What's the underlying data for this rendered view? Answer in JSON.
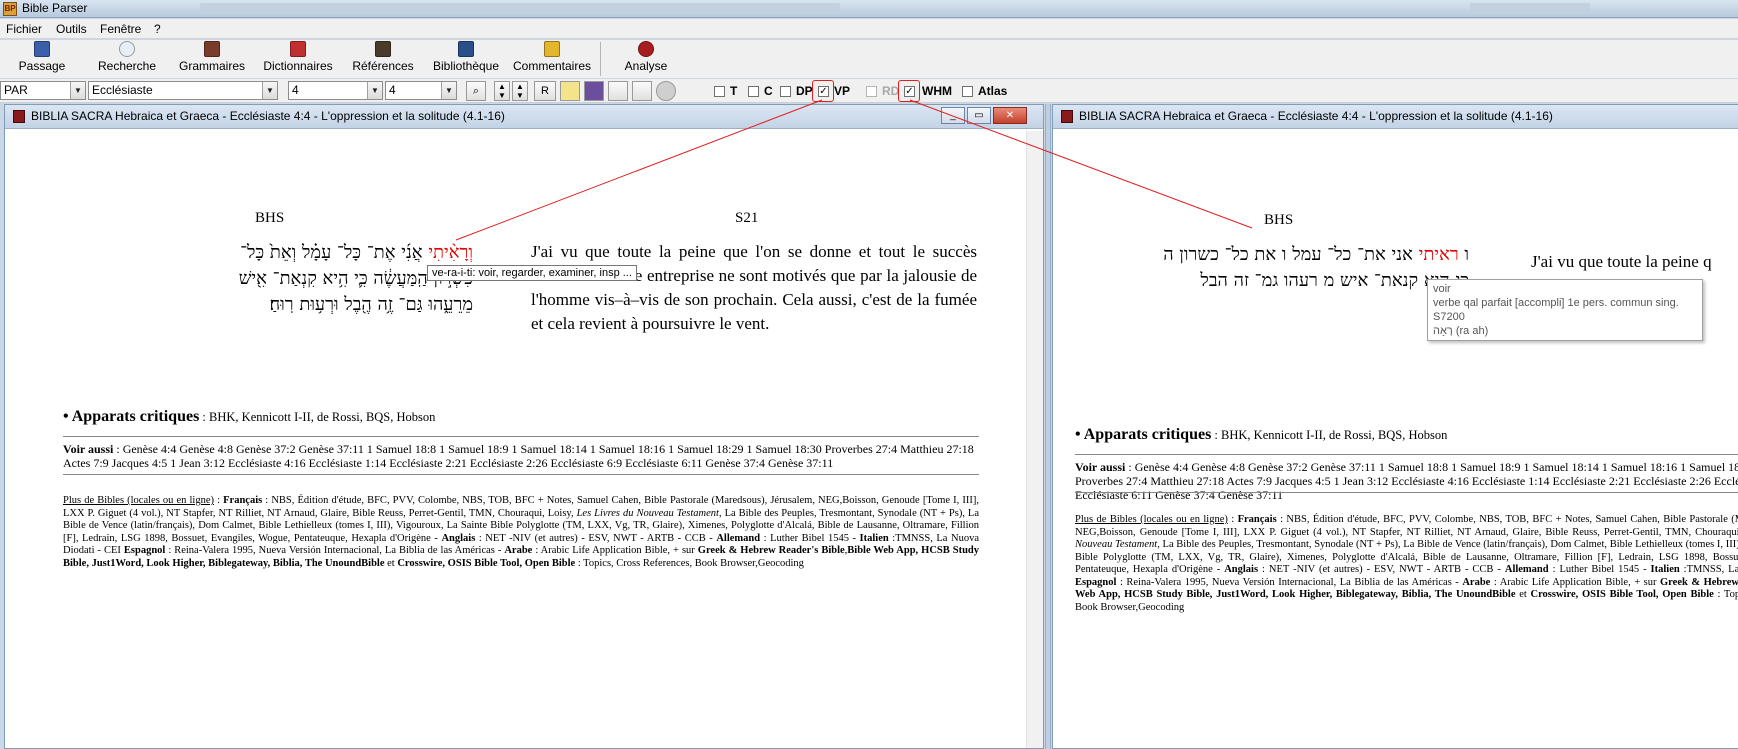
{
  "app": {
    "title": "Bible Parser"
  },
  "menu": {
    "items": [
      "Fichier",
      "Outils",
      "Fenêtre",
      "?"
    ]
  },
  "toolbar": {
    "buttons": [
      {
        "label": "Passage",
        "icon": "book-icon"
      },
      {
        "label": "Recherche",
        "icon": "magnifier-icon"
      },
      {
        "label": "Grammaires",
        "icon": "books-icon"
      },
      {
        "label": "Dictionnaires",
        "icon": "dictionary-icon"
      },
      {
        "label": "Références",
        "icon": "references-icon"
      },
      {
        "label": "Bibliothèque",
        "icon": "library-icon"
      },
      {
        "label": "Commentaires",
        "icon": "commentary-icon"
      },
      {
        "label": "Analyse",
        "icon": "analysis-icon"
      }
    ]
  },
  "selectors": {
    "version": "PAR",
    "book": "Ecclésiaste",
    "chapter": "4",
    "verse": "4",
    "r_label": "R"
  },
  "checkboxes": [
    {
      "label": "T",
      "checked": false,
      "enabled": true
    },
    {
      "label": "C",
      "checked": false,
      "enabled": true
    },
    {
      "label": "DP",
      "checked": false,
      "enabled": true
    },
    {
      "label": "VP",
      "checked": true,
      "enabled": true
    },
    {
      "label": "RD",
      "checked": false,
      "enabled": false
    },
    {
      "label": "WHM",
      "checked": true,
      "enabled": true
    },
    {
      "label": "Atlas",
      "checked": false,
      "enabled": true
    }
  ],
  "left_window": {
    "title": "BIBLIA SACRA Hebraica et Graeca - Ecclésiaste 4:4 - L'oppression et la solitude (4.1-16)",
    "col_bhs": "BHS",
    "col_s21": "S21",
    "hebrew_red": "וְרָאִ֨יתִי",
    "hebrew_line1": "אֲנִ֜י אֶת־ כָּל־ עָמָ֗ל וְאֵת֙ כָּל־",
    "hebrew_line2": "כִּשְׁר֣וֹן הַֽמַּעֲשֶׂ֔ה כִּ֛י הִ֥יא קִנְאַת־ אִ֖ישׁ",
    "hebrew_line3": "מֵרֵעֵ֑הוּ גַּם־ זֶ֥ה הֶ֖בֶל וּרְע֥וּת רֽוּחַ׃",
    "french": "J'ai vu que toute la peine que l'on se donne et tout le succès obtenu dans une entreprise ne sont motivés que par la jalousie de l'homme vis–à–vis de son prochain. Cela aussi, c'est de la fumée et cela revient à poursuivre le vent.",
    "tooltip": "ve-ra-i-ti: voir, regarder, examiner, insp ..."
  },
  "right_window": {
    "title": "BIBLIA SACRA Hebraica et Graeca - Ecclésiaste 4:4 - L'oppression et la solitude (4.1-16)",
    "col_bhs": "BHS",
    "hebrew_red": "ראיתי",
    "hebrew_line1a": "ו",
    "hebrew_line1b": "אני את־ כל־ עמל ו את כל־ כשרון ה",
    "hebrew_line2": "כי היא קנאת־ איש מ רעהו גמ־ זה הבל",
    "hebrew_line3": "רוח",
    "french_partial": "J'ai vu que toute la peine q",
    "tooltip": {
      "line1": "voir",
      "line2": "verbe qal parfait [accompli] 1e pers. commun sing.",
      "line3": "S7200",
      "line4_hebrew": "רָאָה",
      "line4_translit": "(ra ah)"
    }
  },
  "apparats": {
    "bullet": "•",
    "label": "Apparats critiques",
    "sources": " : BHK, Kennicott I-II, de Rossi, BQS, Hobson"
  },
  "voir_aussi": {
    "label": "Voir aussi",
    "refs": " : Genèse 4:4 Genèse 4:8 Genèse 37:2 Genèse 37:11 1 Samuel 18:8 1 Samuel 18:9 1 Samuel 18:14 1 Samuel 18:16 1 Samuel 18:29 1 Samuel 18:30 Proverbes 27:4 Matthieu 27:18 Actes 7:9 Jacques 4:5 1 Jean 3:12 Ecclésiaste 4:16 Ecclésiaste 1:14 Ecclésiaste 2:21 Ecclésiaste 2:26 Ecclésiaste 6:9 Ecclésiaste 6:11 Genèse 37:4 Genèse 37:11"
  },
  "plus_bibles": {
    "link": "Plus de Bibles (locales ou en ligne)",
    "francais_label": "Français",
    "francais": " : NBS, Édition d'étude, BFC, PVV, Colombe, NBS, TOB, BFC + Notes, Samuel Cahen, Bible Pastorale (Maredsous), Jérusalem, NEG,Boisson, Genoude [Tome I, III], LXX P. Giguet (4 vol.), NT Stapfer, NT Rilliet, NT Arnaud, Glaire, Bible Reuss, Perret-Gentil, TMN, Chouraqui, Loisy, ",
    "livres_nt": "Les Livres du Nouveau Testament",
    "francais2": ", La Bible des Peuples, Tresmontant, Synodale (NT + Ps), La Bible de Vence (latin/français), Dom Calmet, Bible Lethielleux (tomes I, III), Vigouroux, La Sainte Bible Polyglotte (TM, LXX, Vg, TR, Glaire), Ximenes, Polyglotte d'Alcalá, Bible de Lausanne, Oltramare, Fillion [F], Ledrain, LSG 1898, Bossuet, Evangiles, Wogue, Pentateuque, Hexapla d'Origène - ",
    "anglais_label": "Anglais",
    "anglais": " : NET -NIV (et autres) - ESV, NWT - ARTB - CCB - ",
    "allemand_label": "Allemand",
    "allemand": " : Luther Bibel 1545 - ",
    "italien_label": "Italien",
    "italien": " :TMNSS, La Nuova Diodati - CEI ",
    "espagnol_label": "Espagnol",
    "espagnol": " : Reina-Valera 1995, Nueva Versión Internacional, La Biblia de las Américas - ",
    "arabe_label": "Arabe",
    "arabe": " : Arabic Life Application Bible, + sur ",
    "greek": "Greek & Hebrew Reader's Bible",
    "links": "Bible Web App, HCSB Study Bible, Just1Word, Look Higher, Biblegateway, Biblia, The UnoundBible",
    "et": " et ",
    "crosswire": "Crosswire, OSIS Bible Tool, Open Bible",
    "tail": " : Topics, Cross References, Book Browser,Geocoding"
  },
  "colors": {
    "red_word": "#e00000",
    "annotation": "#e02020"
  }
}
